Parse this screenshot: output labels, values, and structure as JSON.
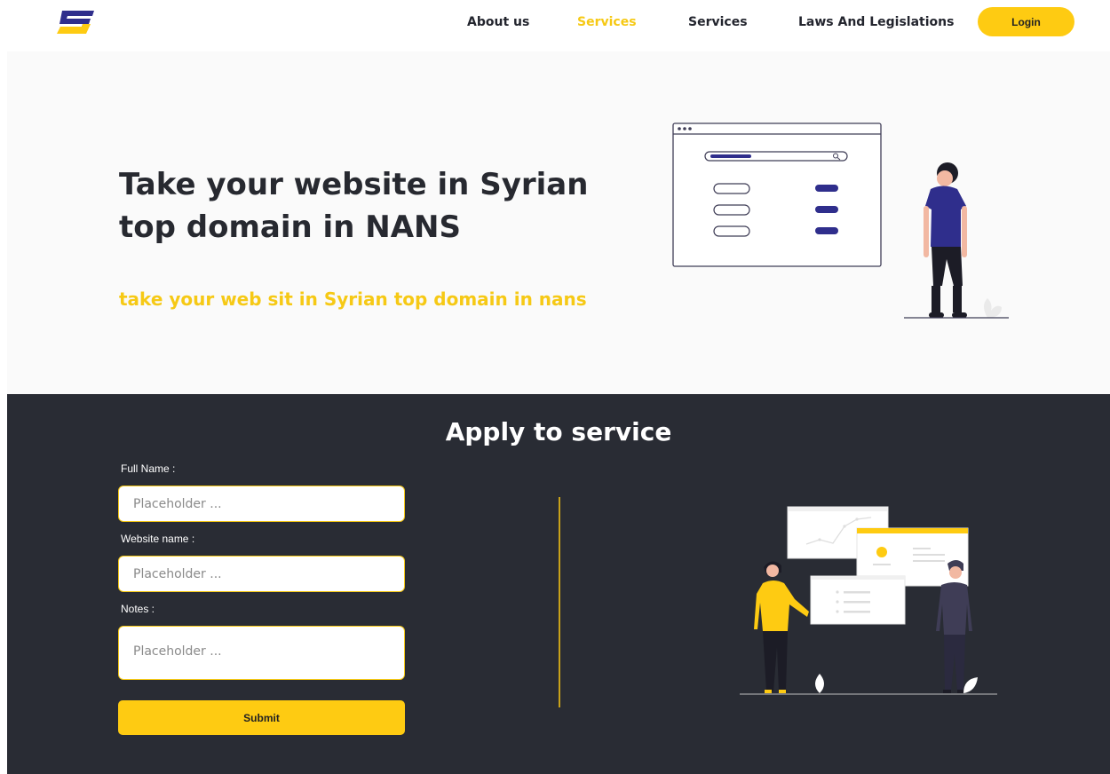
{
  "header": {
    "logo_alt": "logo",
    "nav": {
      "about": "About us",
      "services_active": "Services",
      "services": "Services",
      "laws": "Laws And Legislations"
    },
    "login": "Login"
  },
  "hero": {
    "title": "Take your website in Syrian top domain in NANS",
    "subtitle": "take your web sit in Syrian top domain in nans"
  },
  "apply": {
    "title": "Apply to service",
    "fields": [
      {
        "label": "Full Name :",
        "placeholder": "Placeholder ...",
        "value": ""
      },
      {
        "label": "Website name :",
        "placeholder": "Placeholder ...",
        "value": ""
      },
      {
        "label": "Notes :",
        "placeholder": "Placeholder ...",
        "value": ""
      }
    ],
    "submit": "Submit"
  },
  "colors": {
    "accent": "#fecb12",
    "dark": "#292c34",
    "navy": "#2f2e8c"
  }
}
